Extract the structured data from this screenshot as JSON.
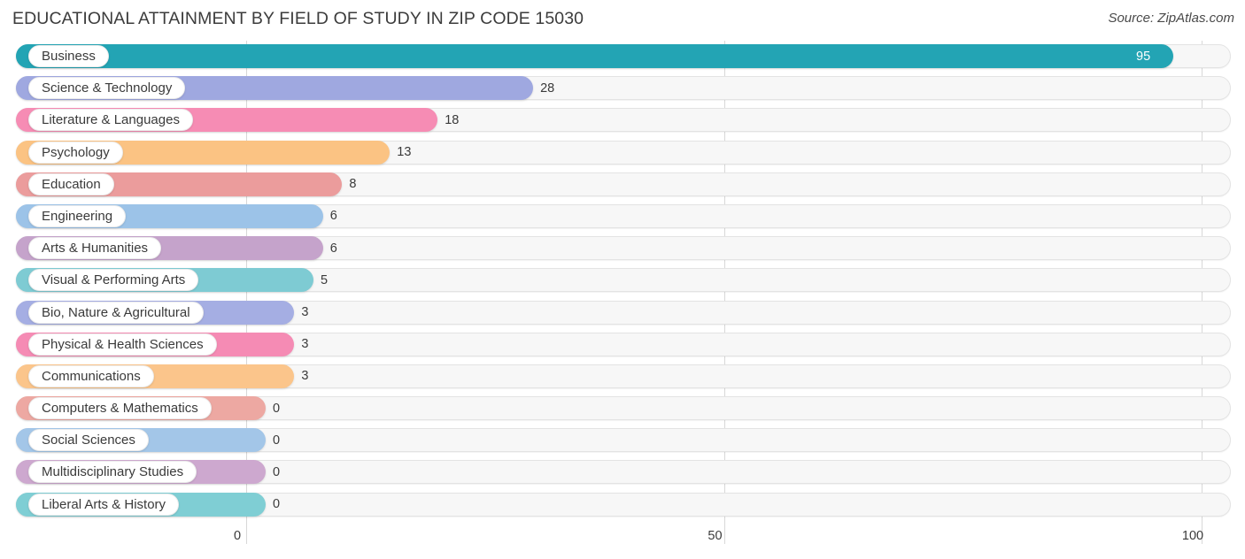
{
  "header": {
    "title": "EDUCATIONAL ATTAINMENT BY FIELD OF STUDY IN ZIP CODE 15030",
    "source": "Source: ZipAtlas.com"
  },
  "chart_data": {
    "type": "bar",
    "orientation": "horizontal",
    "title": "EDUCATIONAL ATTAINMENT BY FIELD OF STUDY IN ZIP CODE 15030",
    "xlabel": "",
    "ylabel": "",
    "xlim": [
      0,
      100
    ],
    "xticks": [
      0,
      50,
      100
    ],
    "xtick_labels": [
      "0",
      "50",
      "100"
    ],
    "grid": true,
    "legend": false,
    "categories": [
      "Business",
      "Science & Technology",
      "Literature & Languages",
      "Psychology",
      "Education",
      "Engineering",
      "Arts & Humanities",
      "Visual & Performing Arts",
      "Bio, Nature & Agricultural",
      "Physical & Health Sciences",
      "Communications",
      "Computers & Mathematics",
      "Social Sciences",
      "Multidisciplinary Studies",
      "Liberal Arts & History"
    ],
    "values": [
      95,
      28,
      18,
      13,
      8,
      6,
      6,
      5,
      3,
      3,
      3,
      0,
      0,
      0,
      0
    ],
    "value_labels": [
      "95",
      "28",
      "18",
      "13",
      "8",
      "6",
      "6",
      "5",
      "3",
      "3",
      "3",
      "0",
      "0",
      "0",
      "0"
    ],
    "colors": [
      "#23a4b4",
      "#9fa8e0",
      "#f68cb4",
      "#fbc383",
      "#eb9c9c",
      "#9cc3e8",
      "#c5a3cb",
      "#7ecbd3",
      "#a5aee3",
      "#f58bb4",
      "#fbc58b",
      "#eda8a2",
      "#a3c6e8",
      "#cda8cf",
      "#7fced4"
    ]
  }
}
